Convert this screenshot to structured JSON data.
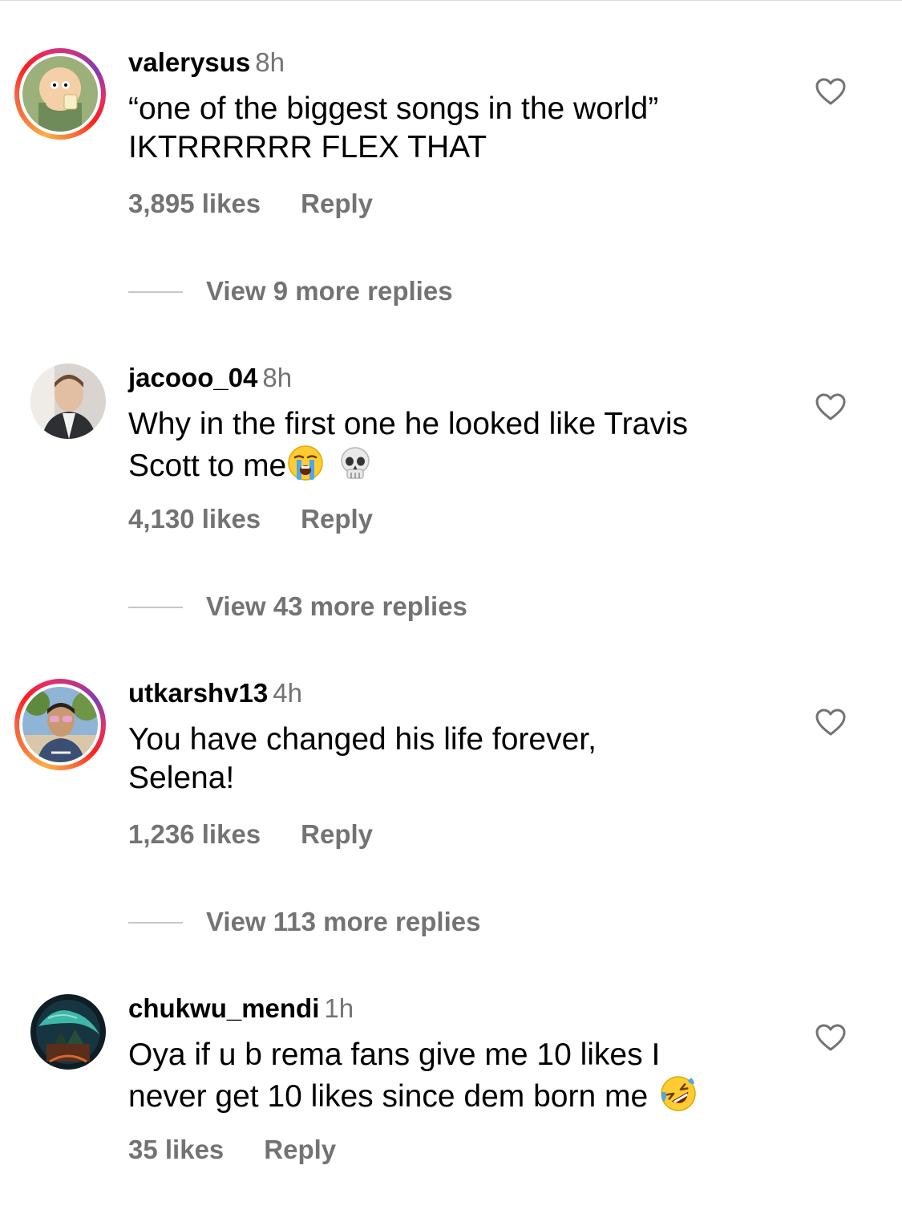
{
  "comments": [
    {
      "username": "valerysus",
      "time": "8h",
      "text_lines": [
        "“one of the biggest songs in the world”",
        "IKTRRRRRR FLEX THAT"
      ],
      "likes": "3,895 likes",
      "reply": "Reply",
      "view_replies": "View 9 more replies",
      "has_story_ring": true
    },
    {
      "username": "jacooo_04",
      "time": "8h",
      "text_lines": [
        "Why in the first one he looked like Travis",
        "Scott to me"
      ],
      "emojis": [
        "loudly-crying-face-emoji",
        "skull-emoji"
      ],
      "likes": "4,130 likes",
      "reply": "Reply",
      "view_replies": "View 43 more replies",
      "has_story_ring": false
    },
    {
      "username": "utkarshv13",
      "time": "4h",
      "text_lines": [
        "You have changed his life forever,",
        "Selena!"
      ],
      "likes": "1,236 likes",
      "reply": "Reply",
      "view_replies": "View 113 more replies",
      "has_story_ring": true
    },
    {
      "username": "chukwu_mendi",
      "time": "1h",
      "text_lines": [
        "Oya if u b rema fans give me 10 likes I",
        "never get 10 likes since dem born me"
      ],
      "emojis": [
        "rolling-on-floor-laughing-emoji"
      ],
      "likes": "35 likes",
      "reply": "Reply",
      "has_story_ring": false
    }
  ],
  "icons": {
    "like": "heart-outline-icon"
  },
  "colors": {
    "secondary_text": "#737373",
    "story_ring": [
      "#fcaf45",
      "#e1306c",
      "#833ab4"
    ]
  }
}
